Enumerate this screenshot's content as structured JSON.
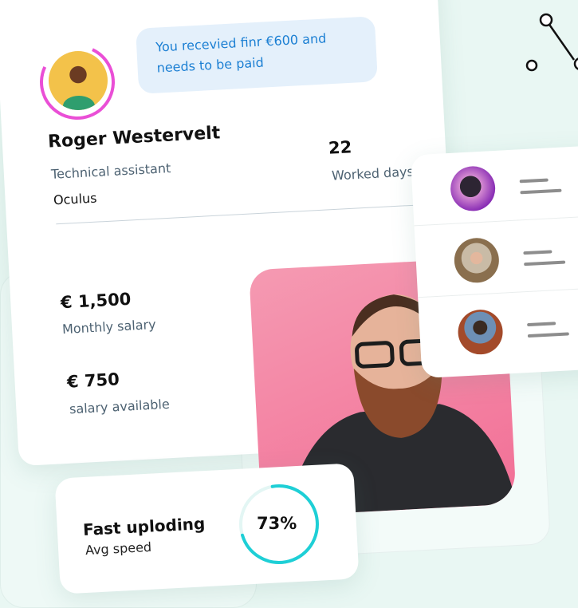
{
  "notification": {
    "message": "You recevied finr €600 and needs to be paid"
  },
  "profile": {
    "name": "Roger Westervelt",
    "role": "Technical assistant",
    "company": "Oculus",
    "worked_days": "22",
    "worked_days_label": "Worked days"
  },
  "salary": {
    "monthly_amount": "€ 1,500",
    "monthly_label": "Monthly salary",
    "available_amount": "€ 750",
    "available_label": "salary available"
  },
  "people_list": {
    "items": [
      {
        "avatar": "woman-purple"
      },
      {
        "avatar": "woman-hijab"
      },
      {
        "avatar": "woman-street"
      }
    ]
  },
  "upload": {
    "title": "Fast uploding",
    "subtitle": "Avg speed",
    "progress_percent": 73,
    "progress_label": "73%"
  },
  "colors": {
    "accent_pink": "#ea4fd6",
    "accent_cyan": "#1ecfd6",
    "message_text": "#1b7fd3",
    "background": "#e9f7f3"
  }
}
